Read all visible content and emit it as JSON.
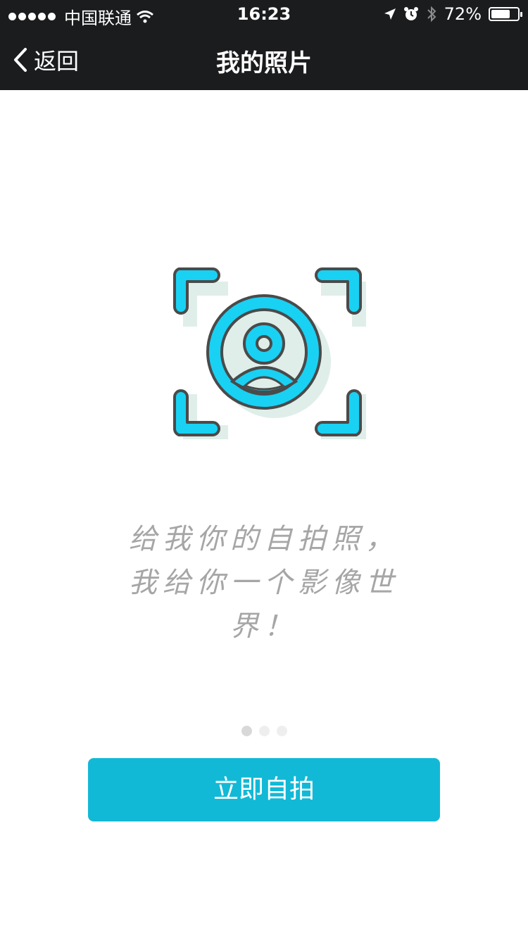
{
  "status_bar": {
    "carrier": "中国联通",
    "time": "16:23",
    "battery_percent": "72%",
    "battery_level": 0.72,
    "icons": [
      "signal-dots-icon",
      "wifi-icon",
      "location-arrow-icon",
      "alarm-icon",
      "bluetooth-icon",
      "battery-icon"
    ]
  },
  "nav": {
    "back_label": "返回",
    "title": "我的照片"
  },
  "content": {
    "tagline_line1": "给我你的自拍照，",
    "tagline_line2": "我给你一个影像世界！"
  },
  "pager": {
    "total": 3,
    "active_index": 0,
    "active_color": "#d8d8d8",
    "inactive_color": "#eeeeee"
  },
  "cta": {
    "label": "立即自拍"
  },
  "colors": {
    "header_bg": "#1b1c1e",
    "accent": "#12b9d6",
    "icon_cyan": "#19d1f3",
    "icon_outline": "#4a4a4a",
    "icon_shadow": "#dfeee9"
  }
}
